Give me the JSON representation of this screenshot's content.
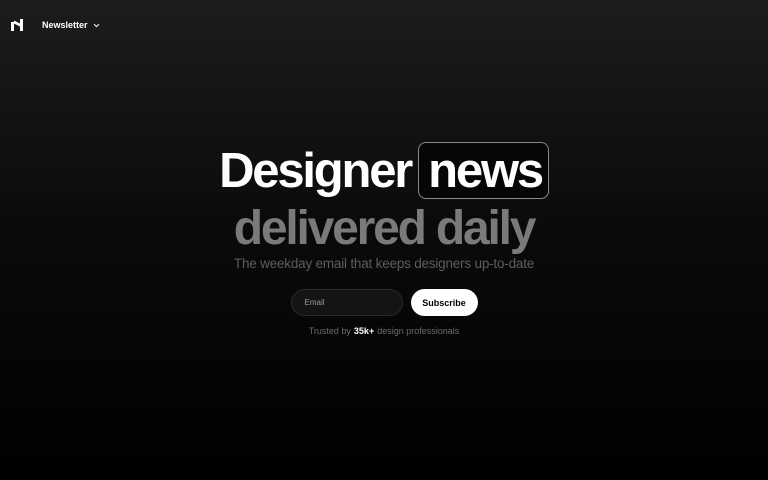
{
  "nav": {
    "logo_icon": "h-logo-icon",
    "menu_label": "Newsletter",
    "menu_icon": "chevron-down-icon"
  },
  "hero": {
    "headline_word_1": "Designer",
    "headline_word_2": "news",
    "headline_line_2": "delivered daily",
    "tagline": "The weekday email that keeps designers up-to-date"
  },
  "form": {
    "email_placeholder": "Email",
    "subscribe_label": "Subscribe"
  },
  "trust": {
    "prefix": "Trusted by",
    "count": "35k+",
    "suffix": "design professionals"
  },
  "colors": {
    "background_top": "#1c1c1c",
    "background_bottom": "#000000",
    "headline_primary": "#ffffff",
    "headline_secondary": "#7a7a7a",
    "button_bg": "#ffffff"
  }
}
